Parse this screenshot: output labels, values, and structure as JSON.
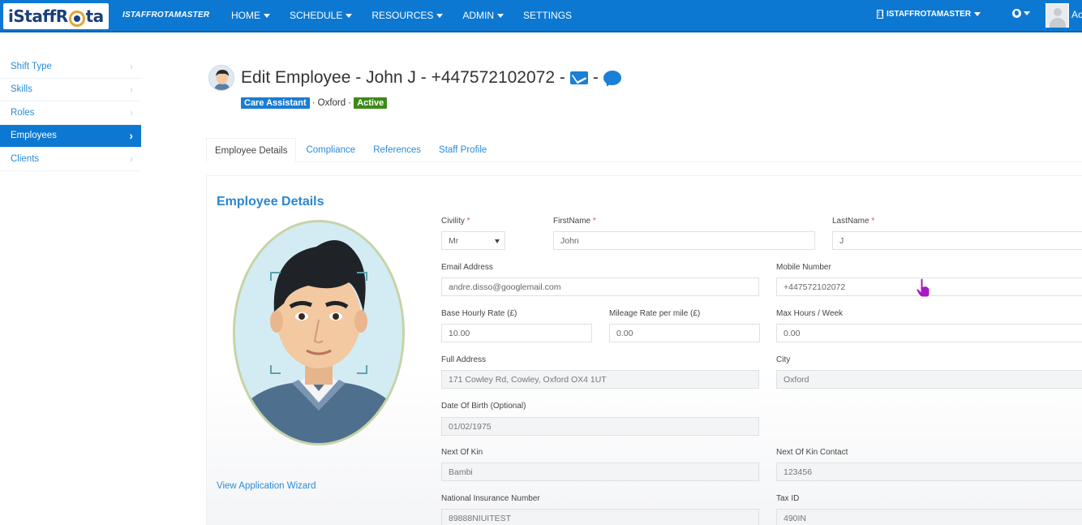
{
  "navbar": {
    "logo_text_a": "iStaffR",
    "logo_text_b": "ta",
    "brand": "ISTAFFROTAMASTER",
    "menu": [
      {
        "label": "HOME",
        "dropdown": true
      },
      {
        "label": "SCHEDULE",
        "dropdown": true
      },
      {
        "label": "RESOURCES",
        "dropdown": true
      },
      {
        "label": "ADMIN",
        "dropdown": true
      },
      {
        "label": "SETTINGS",
        "dropdown": false
      }
    ],
    "org_switch": "ISTAFFROTAMASTER",
    "user_name": "Ac",
    "accent_color": "#0d78d2"
  },
  "sidebar": {
    "items": [
      {
        "label": "Shift Type"
      },
      {
        "label": "Skills"
      },
      {
        "label": "Roles"
      },
      {
        "label": "Employees",
        "active": true
      },
      {
        "label": "Clients"
      }
    ]
  },
  "header": {
    "title": "Edit Employee - John J - +447572102072 -",
    "separator": "-",
    "role_badge": "Care Assistant",
    "location": "· Oxford ·",
    "status_badge": "Active",
    "status_color": "#3c8a1a"
  },
  "tabs": [
    {
      "label": "Employee Details",
      "active": true
    },
    {
      "label": "Compliance"
    },
    {
      "label": "References"
    },
    {
      "label": "Staff Profile"
    }
  ],
  "form": {
    "section_title": "Employee Details",
    "wizard_link": "View Application Wizard",
    "civility": {
      "label": "Civility",
      "value": "Mr"
    },
    "first_name": {
      "label": "FirstName",
      "value": "John"
    },
    "last_name": {
      "label": "LastName",
      "value": "J"
    },
    "email": {
      "label": "Email Address",
      "value": "andre.disso@googlemail.com"
    },
    "mobile": {
      "label": "Mobile Number",
      "value": "+447572102072"
    },
    "base_rate": {
      "label": "Base Hourly Rate (£)",
      "value": "10.00"
    },
    "mileage_rate": {
      "label": "Mileage Rate per mile (£)",
      "value": "0.00"
    },
    "max_hours": {
      "label": "Max Hours / Week",
      "value": "0.00"
    },
    "address": {
      "label": "Full Address",
      "value": "171 Cowley Rd, Cowley, Oxford OX4 1UT"
    },
    "city": {
      "label": "City",
      "value": "Oxford"
    },
    "dob": {
      "label": "Date Of Birth (Optional)",
      "value": "01/02/1975"
    },
    "next_of_kin": {
      "label": "Next Of Kin",
      "value": "Bambi"
    },
    "next_of_kin_contact": {
      "label": "Next Of Kin Contact",
      "value": "123456"
    },
    "ni_number": {
      "label": "National Insurance Number",
      "value": "89888NIUITEST"
    },
    "tax_id": {
      "label": "Tax ID",
      "value": "490IN"
    },
    "required_mark": "*"
  }
}
